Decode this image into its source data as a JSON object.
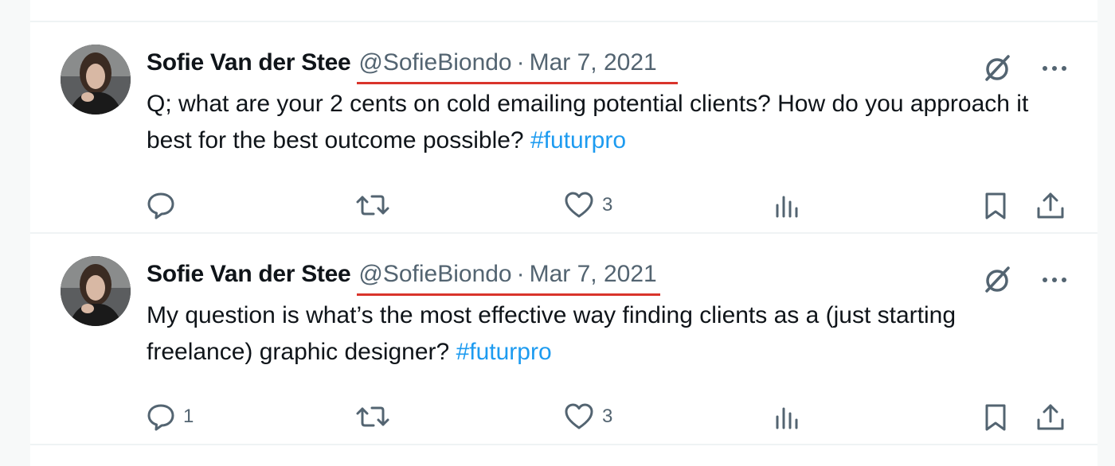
{
  "tweets": [
    {
      "author_name": "Sofie Van der Stee",
      "handle": "@SofieBiondo",
      "separator": "·",
      "date": "Mar 7, 2021",
      "text": "Q; what are your 2 cents on cold emailing potential clients? How do you approach it best for the best outcome possible?",
      "hashtag": "#futurpro",
      "reply_count": "",
      "like_count": "3"
    },
    {
      "author_name": "Sofie Van der Stee",
      "handle": "@SofieBiondo",
      "separator": "·",
      "date": "Mar 7, 2021",
      "text": "My question is what’s the most effective way finding clients as a (just starting freelance) graphic designer?",
      "hashtag": "#futurpro",
      "reply_count": "1",
      "like_count": "3"
    }
  ],
  "icons": {
    "grok": "grok-icon",
    "more": "more-icon",
    "reply": "reply-icon",
    "retweet": "retweet-icon",
    "like": "heart-icon",
    "views": "views-icon",
    "bookmark": "bookmark-icon",
    "share": "share-icon"
  },
  "colors": {
    "hashtag": "#1d9bf0",
    "underline": "#d9342b",
    "icon": "#536471"
  }
}
